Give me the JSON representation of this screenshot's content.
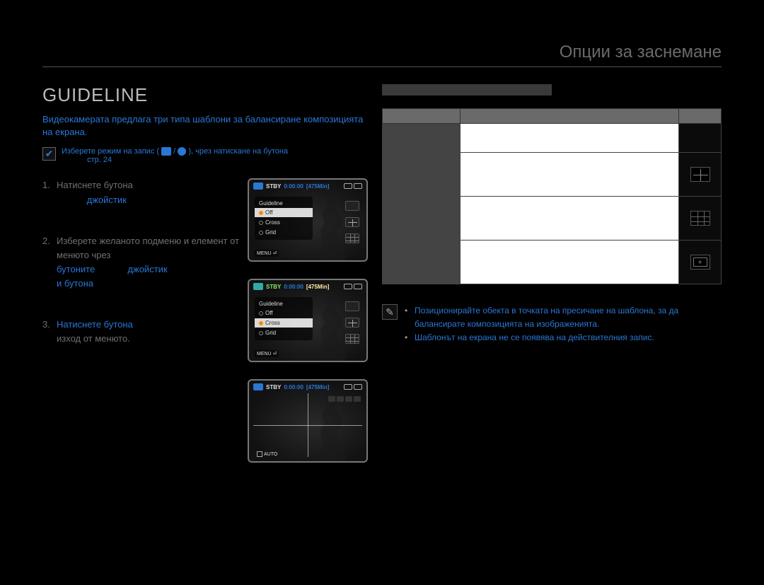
{
  "pre_title": "Опции за заснемане",
  "section_title": "GUIDELINE",
  "blurb": "Видеокамерата предлага три типа шаблони за балансиране композицията на екрана.",
  "preselect": {
    "prefix": "Изберете режим на запис (",
    "middle": " / ",
    "suffix": "), чрез натискане на бутона",
    "page_ref": "стр. 24"
  },
  "steps": [
    {
      "num": "1.",
      "parts": {
        "a": "Натиснете бутона ",
        "b": "джойстик"
      }
    },
    {
      "num": "2.",
      "parts": {
        "a": "Изберете желаното подменю и елемент от менюто чрез",
        "b": "бутоните ",
        "c": "джойстик",
        "d": "и бутона "
      }
    },
    {
      "num": "3.",
      "parts": {
        "a": "Натиснете бутона ",
        "b": "изход от менюто."
      }
    }
  ],
  "camscreens": {
    "status": {
      "stby": "STBY",
      "time": "0:00:00",
      "remain": "[475Min]"
    },
    "menu_title": "Guideline",
    "items": {
      "off": "Off",
      "cross": "Cross",
      "grid": "Grid"
    },
    "menu_btn": "MENU",
    "live_auto": "AUTO"
  },
  "options_table": {
    "headers": {
      "name": "",
      "desc": "",
      "icon": ""
    },
    "rows": [
      {
        "name": "",
        "desc": "",
        "icon": "none"
      },
      {
        "name": "",
        "desc": "",
        "icon": "cross"
      },
      {
        "name": "",
        "desc": "",
        "icon": "grid"
      },
      {
        "name": "",
        "desc": "",
        "icon": "safety"
      }
    ]
  },
  "notes": {
    "line1": "Позиционирайте обекта в точката на пресичане на шаблона, за да балансирате композицията на изображенията.",
    "line2": "Шаблонът на екрана не се появява на действителния запис."
  }
}
